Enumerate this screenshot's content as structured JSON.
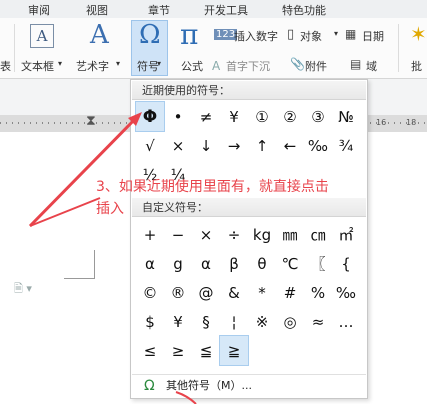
{
  "tabs": [
    "审阅",
    "视图",
    "章节",
    "开发工具",
    "特色功能"
  ],
  "ribbon": {
    "left_cut": "表",
    "textbox": "文本框",
    "arttext": "艺术字",
    "symbol": "符号",
    "formula": "公式",
    "insert_number": "插入数字",
    "object": "对象",
    "date": "日期",
    "first_sink": "首字下沉",
    "attachment": "附件",
    "field": "域",
    "batch": "批"
  },
  "ruler_numbers": [
    "16",
    "18"
  ],
  "dropdown": {
    "recent_header": "近期使用的符号：",
    "recent_symbols": [
      "Φ",
      "•",
      "≠",
      "¥",
      "①",
      "②",
      "③",
      "№",
      "√",
      "×",
      "↓",
      "→",
      "↑",
      "←",
      "‰",
      "¾",
      "½",
      "¼"
    ],
    "custom_header": "自定义符号：",
    "custom_symbols": [
      "+",
      "−",
      "×",
      "÷",
      "kg",
      "㎜",
      "㎝",
      "㎡",
      "α",
      "g",
      "α",
      "β",
      "θ",
      "℃",
      "〖",
      "{",
      "©",
      "®",
      "@",
      "&",
      "*",
      "#",
      "%",
      "‰",
      "$",
      "¥",
      "§",
      "¦",
      "※",
      "◎",
      "≈",
      "…",
      "≤",
      "≥",
      "≦",
      "≧"
    ],
    "more_label": "其他符号（M）..."
  },
  "annotation": {
    "line1": "3、如果近期使用里面有，就直接点击",
    "line2": "插入"
  },
  "colors": {
    "accent": "#e8434b",
    "highlight": "#d6e8f8",
    "symbol_button": "#cfe3f7"
  }
}
